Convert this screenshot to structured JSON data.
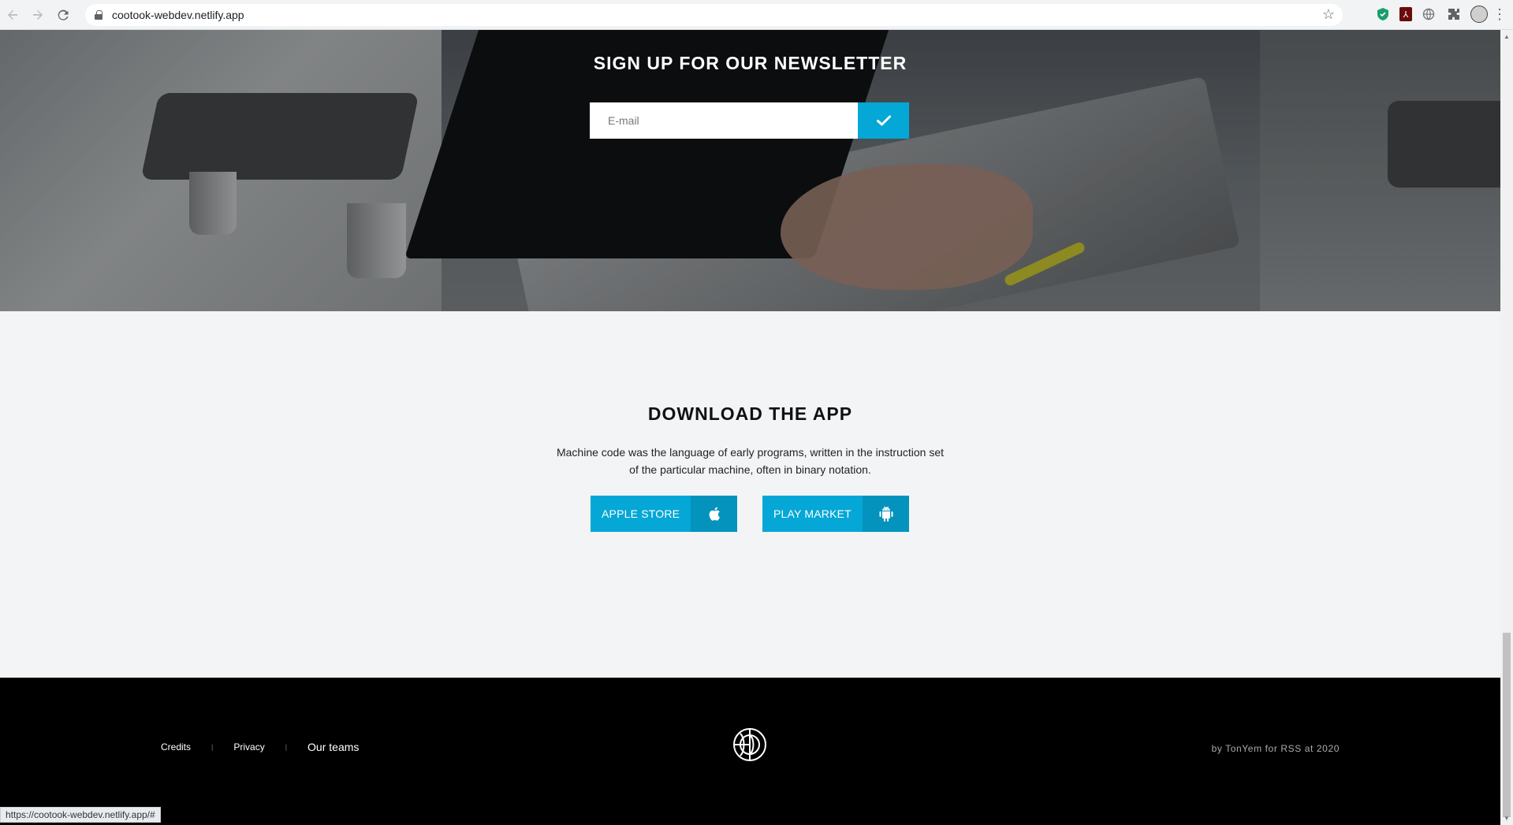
{
  "browser": {
    "url": "cootook-webdev.netlify.app",
    "status_url": "https://cootook-webdev.netlify.app/#",
    "icons": [
      "back-icon",
      "forward-icon",
      "reload-icon",
      "lock-icon",
      "star-icon",
      "shield-extension-icon",
      "pdf-extension-icon",
      "globe-extension-icon",
      "puzzle-extension-icon",
      "profile-avatar",
      "menu-icon"
    ]
  },
  "newsletter": {
    "title": "SIGN UP FOR OUR NEWSLETTER",
    "email_placeholder": "E-mail",
    "submit_icon": "check-icon"
  },
  "download": {
    "title": "DOWNLOAD THE APP",
    "text": "Machine code was the language of early programs, written in the instruction set of the particular machine, often in binary notation.",
    "apple_label": "APPLE STORE",
    "apple_icon": "apple-icon",
    "android_label": "PLAY MARKET",
    "android_icon": "android-icon"
  },
  "footer": {
    "links": [
      "Credits",
      "Privacy",
      "Our teams"
    ],
    "separator": "|",
    "credit": "by TonYem for RSS at 2020",
    "logo_icon": "globe-logo-icon"
  },
  "colors": {
    "accent": "#04a7d6",
    "accent_dark": "#0493bd",
    "footer_bg": "#000000",
    "section_bg": "#f3f4f5"
  }
}
